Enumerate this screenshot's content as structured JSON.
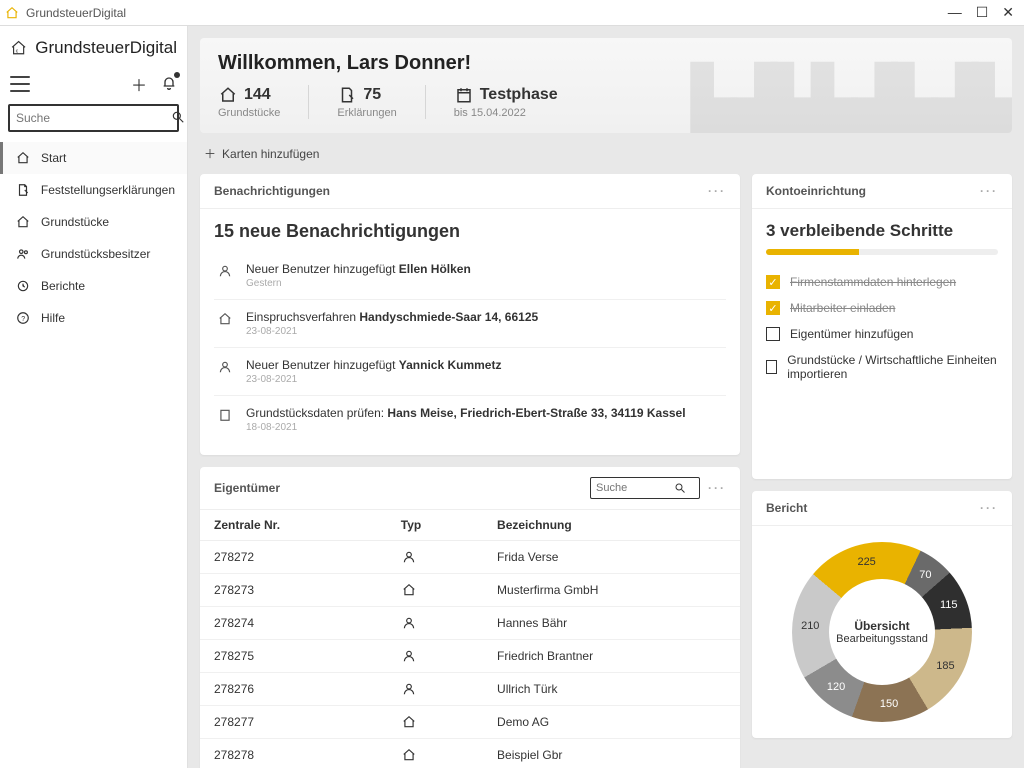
{
  "app": {
    "title": "GrundsteuerDigital",
    "brand": "GrundsteuerDigital"
  },
  "search": {
    "placeholder": "Suche"
  },
  "nav": {
    "items": [
      {
        "label": "Start"
      },
      {
        "label": "Feststellungserklärungen"
      },
      {
        "label": "Grundstücke"
      },
      {
        "label": "Grundstücksbesitzer"
      },
      {
        "label": "Berichte"
      },
      {
        "label": "Hilfe"
      }
    ]
  },
  "welcome": {
    "greeting": "Willkommen, Lars Donner!",
    "stats": {
      "plots": {
        "value": "144",
        "label": "Grundstücke"
      },
      "declarations": {
        "value": "75",
        "label": "Erklärungen"
      },
      "phase": {
        "value": "Testphase",
        "label": "bis 15.04.2022"
      }
    }
  },
  "addCards": "Karten hinzufügen",
  "notifications": {
    "header": "Benachrichtigungen",
    "title": "15 neue Benachrichtigungen",
    "items": [
      {
        "prefix": "Neuer Benutzer hinzugefügt ",
        "bold": "Ellen Hölken",
        "date": "Gestern",
        "icon": "user"
      },
      {
        "prefix": "Einspruchsverfahren ",
        "bold": "Handyschmiede-Saar 14, 66125",
        "date": "23-08-2021",
        "icon": "house"
      },
      {
        "prefix": "Neuer Benutzer hinzugefügt ",
        "bold": "Yannick Kummetz",
        "date": "23-08-2021",
        "icon": "user"
      },
      {
        "prefix": "Grundstücksdaten prüfen: ",
        "bold": "Hans Meise, Friedrich-Ebert-Straße 33, 34119 Kassel",
        "date": "18-08-2021",
        "icon": "building"
      }
    ]
  },
  "owners": {
    "header": "Eigentümer",
    "searchPlaceholder": "Suche",
    "columns": {
      "nr": "Zentrale Nr.",
      "type": "Typ",
      "name": "Bezeichnung"
    },
    "rows": [
      {
        "nr": "278272",
        "type": "person",
        "name": "Frida Verse"
      },
      {
        "nr": "278273",
        "type": "company",
        "name": "Musterfirma GmbH"
      },
      {
        "nr": "278274",
        "type": "person",
        "name": "Hannes Bähr"
      },
      {
        "nr": "278275",
        "type": "person",
        "name": "Friedrich Brantner"
      },
      {
        "nr": "278276",
        "type": "person",
        "name": "Ullrich Türk"
      },
      {
        "nr": "278277",
        "type": "company",
        "name": "Demo AG"
      },
      {
        "nr": "278278",
        "type": "company",
        "name": "Beispiel Gbr"
      }
    ]
  },
  "setup": {
    "header": "Kontoeinrichtung",
    "title": "3 verbleibende Schritte",
    "progressPct": 40,
    "steps": [
      {
        "label": "Firmenstammdaten hinterlegen",
        "done": true
      },
      {
        "label": "Mitarbeiter einladen",
        "done": true
      },
      {
        "label": "Eigentümer hinzufügen",
        "done": false
      },
      {
        "label": "Grundstücke / Wirtschaftliche Einheiten importieren",
        "done": false
      }
    ]
  },
  "report": {
    "header": "Bericht",
    "centerTitle": "Übersicht",
    "centerSub": "Bearbeitungsstand"
  },
  "chart_data": {
    "type": "pie",
    "title": "Übersicht Bearbeitungsstand",
    "series": [
      {
        "name": "225",
        "value": 225,
        "color": "#e9b300"
      },
      {
        "name": "70",
        "value": 70,
        "color": "#6a6a6a"
      },
      {
        "name": "115",
        "value": 115,
        "color": "#2f2f2f"
      },
      {
        "name": "185",
        "value": 185,
        "color": "#cdb88b"
      },
      {
        "name": "150",
        "value": 150,
        "color": "#8c7354"
      },
      {
        "name": "120",
        "value": 120,
        "color": "#8c8c8c"
      },
      {
        "name": "210",
        "value": 210,
        "color": "#c9c9c9"
      }
    ]
  }
}
